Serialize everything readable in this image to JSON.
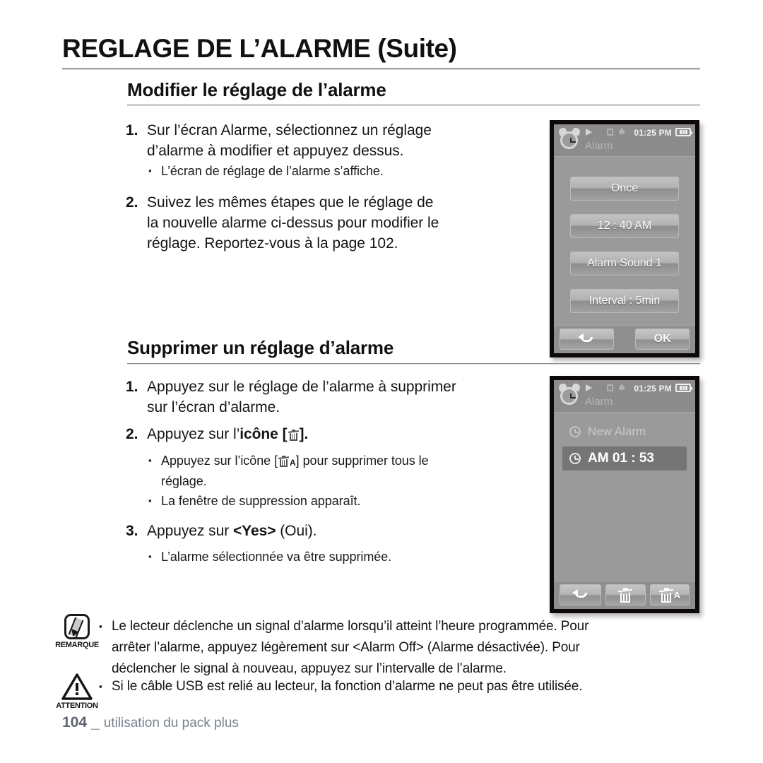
{
  "page": {
    "title": "REGLAGE DE L’ALARME (Suite)",
    "footer_page_number": "104",
    "footer_separator": "_",
    "footer_text": "utilisation du pack plus"
  },
  "sections": [
    {
      "heading": "Modifier le réglage de l’alarme",
      "steps": [
        {
          "num": "1.",
          "text": "Sur l’écran Alarme, sélectionnez un réglage d’alarme à modifier et appuyez dessus.",
          "bullets": [
            "L’écran de réglage de l’alarme s’affiche."
          ]
        },
        {
          "num": "2.",
          "text": "Suivez les mêmes étapes que le réglage de la nouvelle alarme ci-dessus pour modifier le réglage. Reportez-vous à la page 102.",
          "bullets": []
        }
      ]
    },
    {
      "heading": "Supprimer un réglage d’alarme",
      "steps": [
        {
          "num": "1.",
          "text": "Appuyez sur le réglage de l’alarme à supprimer sur l’écran d’alarme.",
          "bullets": []
        },
        {
          "num": "2.",
          "text_pre": "Appuyez sur l’",
          "text_bold": "icône [",
          "text_post": "].",
          "bullets": [
            "Appuyez sur l’icône [  ] pour supprimer tous le réglage.",
            "La fenêtre de suppression apparaît."
          ]
        },
        {
          "num": "3.",
          "text_pre": "Appuyez sur ",
          "text_bold": "<Yes>",
          "text_post": " (Oui).",
          "bullets": [
            "L’alarme sélectionnée va être supprimée."
          ]
        }
      ]
    }
  ],
  "bullets_flat": {
    "b1": "L’écran de réglage de l’alarme s’affiche.",
    "b2_pre": "Appuyez sur l’icône [",
    "b2_post": "] pour supprimer tous le",
    "b2_line2": "réglage.",
    "b3": "La fenêtre de suppression apparaît.",
    "b4": "L’alarme sélectionnée va être supprimée."
  },
  "step_lines": {
    "s1_l1": "Sur l’écran Alarme, sélectionnez un réglage",
    "s1_l2": "d’alarme à modifier et appuyez dessus.",
    "s2_l1": "Suivez les mêmes étapes que le réglage de",
    "s2_l2": "la nouvelle alarme ci-dessus pour modifier le",
    "s2_l3": "réglage. Reportez-vous à la page 102.",
    "d1_l1": "Appuyez sur le réglage de l’alarme à supprimer",
    "d1_l2": "sur l’écran d’alarme.",
    "d2_pre": "Appuyez sur l’",
    "d2_bold_open": "icône [",
    "d2_bold_close": "].",
    "d3_pre": "Appuyez sur ",
    "d3_bold": "<Yes>",
    "d3_post": " (Oui)."
  },
  "device_alarm_setting": {
    "status": {
      "title": "Alarm",
      "time": "01:25 PM",
      "icons": [
        "clock-icon",
        "play-icon",
        "usb-icon",
        "bell-icon",
        "battery-icon"
      ]
    },
    "buttons": [
      "Once",
      "12 : 40 AM",
      "Alarm Sound 1",
      "Interval : 5min"
    ],
    "softkeys": [
      {
        "name": "back",
        "label": ""
      },
      {
        "name": "ok",
        "label": "OK"
      }
    ]
  },
  "device_alarm_list": {
    "status": {
      "title": "Alarm",
      "time": "01:25 PM"
    },
    "rows": [
      {
        "label": "New Alarm",
        "selected": false
      },
      {
        "label": "AM 01 : 53",
        "selected": true
      }
    ],
    "softkeys": [
      {
        "name": "back",
        "label": ""
      },
      {
        "name": "delete",
        "label": ""
      },
      {
        "name": "delete-all",
        "label": "A"
      }
    ]
  },
  "notes": [
    {
      "icon_label": "REMARQUE",
      "lines": [
        "Le lecteur déclenche un signal d’alarme lorsqu’il atteint l’heure programmée. Pour",
        "arrêter l’alarme, appuyez légèrement sur <Alarm Off> (Alarme désactivée). Pour",
        "déclencher le signal à nouveau, appuyez sur l’intervalle de l’alarme."
      ]
    },
    {
      "icon_label": "ATTENTION",
      "lines": [
        "Si le câble USB est relié au lecteur, la fonction d’alarme ne peut pas être utilisée."
      ]
    }
  ],
  "colors": {
    "text": "#151515",
    "footer": "#7a8190",
    "device_bezel": "#0d0909",
    "screen_bg": "#9a9a9a",
    "selected_row": "#757575"
  }
}
